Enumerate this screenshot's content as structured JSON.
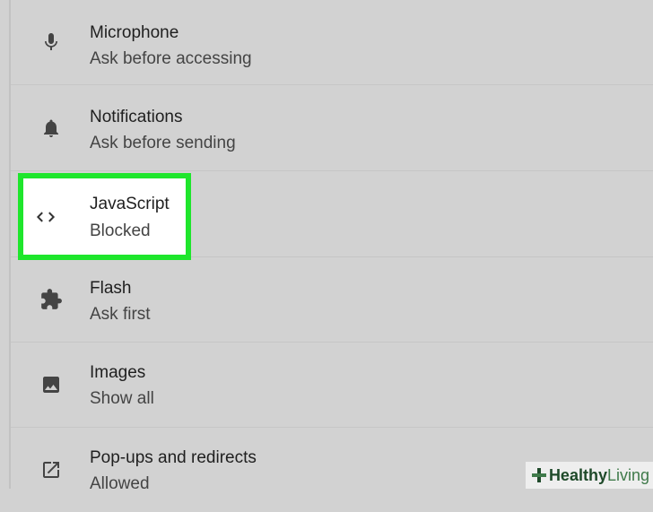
{
  "settings": {
    "items": [
      {
        "title": "Microphone",
        "status": "Ask before accessing",
        "icon": "microphone-icon"
      },
      {
        "title": "Notifications",
        "status": "Ask before sending",
        "icon": "bell-icon"
      },
      {
        "title": "JavaScript",
        "status": "Blocked",
        "icon": "code-icon"
      },
      {
        "title": "Flash",
        "status": "Ask first",
        "icon": "puzzle-piece-icon"
      },
      {
        "title": "Images",
        "status": "Show all",
        "icon": "image-icon"
      },
      {
        "title": "Pop-ups and redirects",
        "status": "Allowed",
        "icon": "external-link-icon"
      }
    ]
  },
  "highlight_color": "#1ee62c",
  "watermark": {
    "brand_part1": "Healthy",
    "brand_part2": " Living",
    "icon": "plus-logo-icon"
  }
}
